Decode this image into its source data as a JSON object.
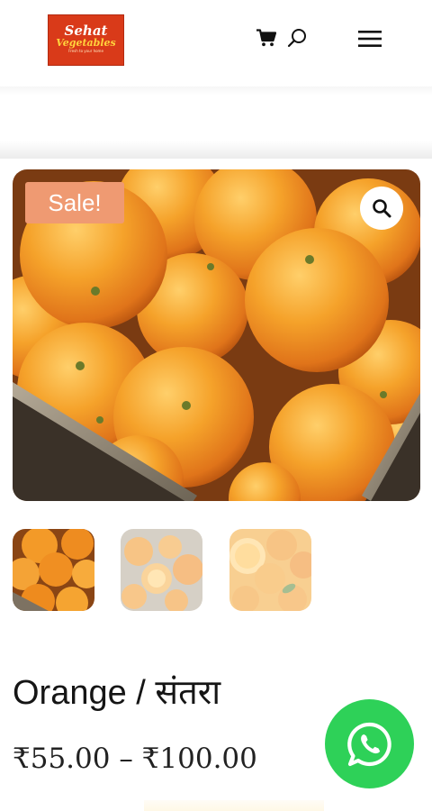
{
  "header": {
    "logo": {
      "line1": "Sehat",
      "line2": "Vegetables",
      "line3": "Fresh to your home"
    },
    "cart_icon": "cart-icon",
    "search_icon": "search-icon",
    "menu_icon": "hamburger-menu-icon"
  },
  "product": {
    "sale_badge": "Sale!",
    "zoom_icon": "magnifier-icon",
    "thumbnails": [
      "oranges-crate",
      "orange-slices",
      "oranges-halves"
    ],
    "title": "Orange / संतरा",
    "price": "₹55.00 – ₹100.00"
  },
  "whatsapp": {
    "icon": "whatsapp-icon",
    "color": "#2ed158"
  },
  "colors": {
    "sale_badge": "#ef9a72",
    "logo_bg": "#d93a19",
    "orange": "#f08a1c"
  }
}
